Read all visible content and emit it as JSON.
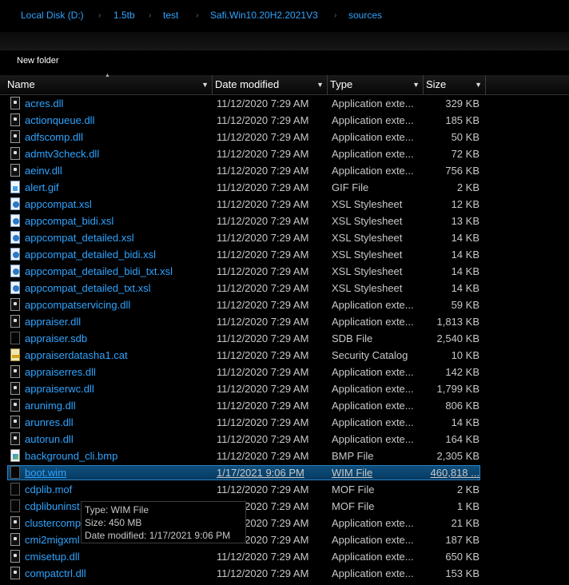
{
  "breadcrumb": [
    "Local Disk (D:)",
    "1.5tb",
    "test",
    "Safi.Win10.20H2.2021V3",
    "sources"
  ],
  "toolbar": {
    "new_folder": "New folder"
  },
  "columns": {
    "name": "Name",
    "date": "Date modified",
    "type": "Type",
    "size": "Size"
  },
  "files": [
    {
      "name": "acres.dll",
      "date": "11/12/2020 7:29 AM",
      "type": "Application exte...",
      "size": "329 KB",
      "icon": "dll-icon"
    },
    {
      "name": "actionqueue.dll",
      "date": "11/12/2020 7:29 AM",
      "type": "Application exte...",
      "size": "185 KB",
      "icon": "dll-icon"
    },
    {
      "name": "adfscomp.dll",
      "date": "11/12/2020 7:29 AM",
      "type": "Application exte...",
      "size": "50 KB",
      "icon": "dll-icon"
    },
    {
      "name": "admtv3check.dll",
      "date": "11/12/2020 7:29 AM",
      "type": "Application exte...",
      "size": "72 KB",
      "icon": "dll-icon"
    },
    {
      "name": "aeinv.dll",
      "date": "11/12/2020 7:29 AM",
      "type": "Application exte...",
      "size": "756 KB",
      "icon": "dll-icon"
    },
    {
      "name": "alert.gif",
      "date": "11/12/2020 7:29 AM",
      "type": "GIF File",
      "size": "2 KB",
      "icon": "gif-icon"
    },
    {
      "name": "appcompat.xsl",
      "date": "11/12/2020 7:29 AM",
      "type": "XSL Stylesheet",
      "size": "12 KB",
      "icon": "xsl-icon"
    },
    {
      "name": "appcompat_bidi.xsl",
      "date": "11/12/2020 7:29 AM",
      "type": "XSL Stylesheet",
      "size": "13 KB",
      "icon": "xsl-icon"
    },
    {
      "name": "appcompat_detailed.xsl",
      "date": "11/12/2020 7:29 AM",
      "type": "XSL Stylesheet",
      "size": "14 KB",
      "icon": "xsl-icon"
    },
    {
      "name": "appcompat_detailed_bidi.xsl",
      "date": "11/12/2020 7:29 AM",
      "type": "XSL Stylesheet",
      "size": "14 KB",
      "icon": "xsl-icon"
    },
    {
      "name": "appcompat_detailed_bidi_txt.xsl",
      "date": "11/12/2020 7:29 AM",
      "type": "XSL Stylesheet",
      "size": "14 KB",
      "icon": "xsl-icon"
    },
    {
      "name": "appcompat_detailed_txt.xsl",
      "date": "11/12/2020 7:29 AM",
      "type": "XSL Stylesheet",
      "size": "14 KB",
      "icon": "xsl-icon"
    },
    {
      "name": "appcompatservicing.dll",
      "date": "11/12/2020 7:29 AM",
      "type": "Application exte...",
      "size": "59 KB",
      "icon": "dll-icon"
    },
    {
      "name": "appraiser.dll",
      "date": "11/12/2020 7:29 AM",
      "type": "Application exte...",
      "size": "1,813 KB",
      "icon": "dll-icon"
    },
    {
      "name": "appraiser.sdb",
      "date": "11/12/2020 7:29 AM",
      "type": "SDB File",
      "size": "2,540 KB",
      "icon": "blank-file-icon"
    },
    {
      "name": "appraiserdatasha1.cat",
      "date": "11/12/2020 7:29 AM",
      "type": "Security Catalog",
      "size": "10 KB",
      "icon": "cat-icon"
    },
    {
      "name": "appraiserres.dll",
      "date": "11/12/2020 7:29 AM",
      "type": "Application exte...",
      "size": "142 KB",
      "icon": "dll-icon"
    },
    {
      "name": "appraiserwc.dll",
      "date": "11/12/2020 7:29 AM",
      "type": "Application exte...",
      "size": "1,799 KB",
      "icon": "dll-icon"
    },
    {
      "name": "arunimg.dll",
      "date": "11/12/2020 7:29 AM",
      "type": "Application exte...",
      "size": "806 KB",
      "icon": "dll-icon"
    },
    {
      "name": "arunres.dll",
      "date": "11/12/2020 7:29 AM",
      "type": "Application exte...",
      "size": "14 KB",
      "icon": "dll-icon"
    },
    {
      "name": "autorun.dll",
      "date": "11/12/2020 7:29 AM",
      "type": "Application exte...",
      "size": "164 KB",
      "icon": "dll-icon"
    },
    {
      "name": "background_cli.bmp",
      "date": "11/12/2020 7:29 AM",
      "type": "BMP File",
      "size": "2,305 KB",
      "icon": "bmp-icon"
    },
    {
      "name": "boot.wim",
      "date": "1/17/2021 9:06 PM",
      "type": "WIM File",
      "size": "460,818 ...",
      "icon": "blank-file-icon",
      "selected": true
    },
    {
      "name": "cdplib.mof",
      "date": "11/12/2020 7:29 AM",
      "type": "MOF File",
      "size": "2 KB",
      "icon": "blank-file-icon"
    },
    {
      "name": "cdplibuninst",
      "date": "11/12/2020 7:29 AM",
      "type": "MOF File",
      "size": "1 KB",
      "icon": "blank-file-icon"
    },
    {
      "name": "clustercomp",
      "date": "11/12/2020 7:29 AM",
      "type": "Application exte...",
      "size": "21 KB",
      "icon": "dll-icon"
    },
    {
      "name": "cmi2migxml",
      "date": "11/12/2020 7:29 AM",
      "type": "Application exte...",
      "size": "187 KB",
      "icon": "dll-icon"
    },
    {
      "name": "cmisetup.dll",
      "date": "11/12/2020 7:29 AM",
      "type": "Application exte...",
      "size": "650 KB",
      "icon": "dll-icon"
    },
    {
      "name": "compatctrl.dll",
      "date": "11/12/2020 7:29 AM",
      "type": "Application exte...",
      "size": "153 KB",
      "icon": "dll-icon"
    }
  ],
  "tooltip": {
    "type": "Type: WIM File",
    "size": "Size: 450 MB",
    "date": "Date modified: 1/17/2021 9:06 PM"
  },
  "colors": {
    "link": "#2fa4ff",
    "selection": "#0f4f7d",
    "background": "#000000"
  }
}
